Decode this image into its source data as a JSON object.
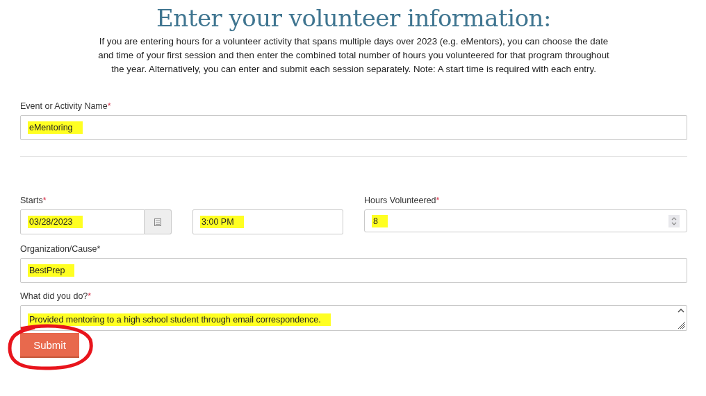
{
  "heading": {
    "title": "Enter your volunteer information:",
    "intro": "If you are entering hours for a volunteer activity that spans multiple days over 2023 (e.g. eMentors), you can choose the date and time of your first session and then enter the combined total number of hours you volunteered for that program throughout the year. Alternatively, you can enter and submit each session separately. Note: A start time is required with each entry."
  },
  "fields": [
    {
      "kind": "text",
      "label": "Event or Activity Name",
      "required_mark": "*",
      "value": "eMentoring",
      "highlighted": true
    },
    {
      "kind": "divider"
    },
    {
      "kind": "date_time",
      "label": "Starts",
      "required_mark": "*",
      "date": "03/28/2023",
      "time": "3:00 PM",
      "highlighted": true,
      "side": {
        "label": "Hours Volunteered",
        "required_mark": "*",
        "value": "8",
        "highlighted": true
      }
    },
    {
      "kind": "text",
      "label": "Organization/Cause*",
      "value": "BestPrep",
      "highlighted": true
    },
    {
      "kind": "textarea",
      "label": "What did you do?",
      "required_mark": "*",
      "value": "Provided mentoring to a high school student through email correspondence.",
      "highlighted": true
    }
  ],
  "submit": {
    "label": "Submit",
    "circled": true
  }
}
